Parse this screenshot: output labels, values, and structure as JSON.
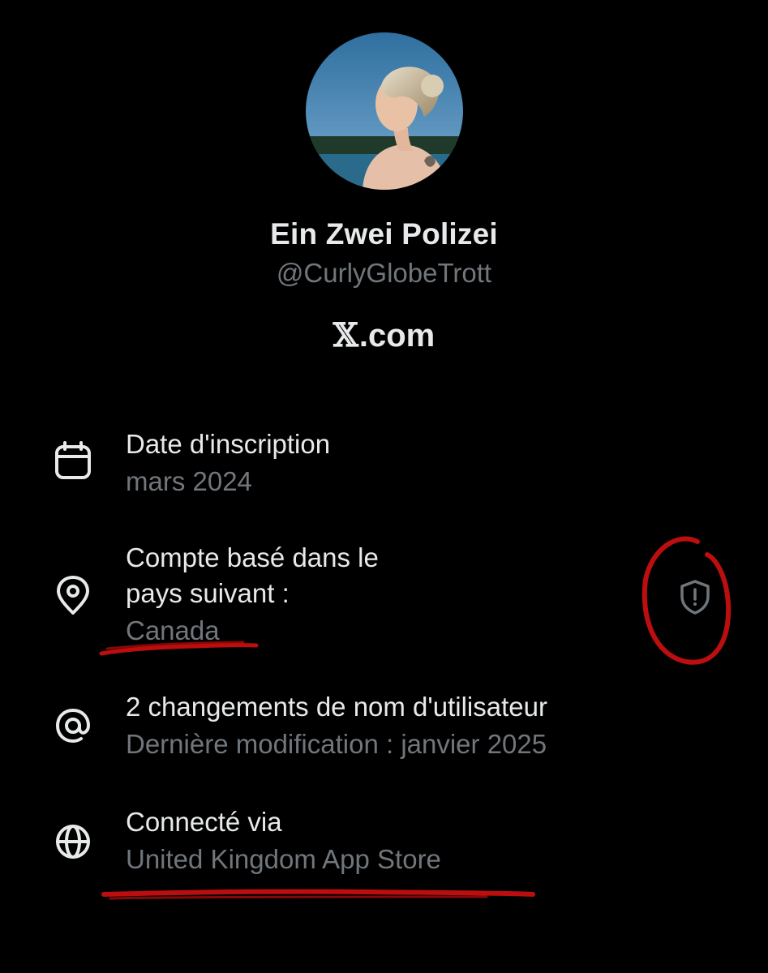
{
  "profile": {
    "display_name": "Ein Zwei Polizei",
    "handle": "@CurlyGlobeTrott",
    "brand_x": "𝕏",
    "brand_suffix": ".com"
  },
  "rows": [
    {
      "icon": "calendar-icon",
      "title": "Date d'inscription",
      "subtitle": "mars 2024"
    },
    {
      "icon": "location-pin-icon",
      "title_line1": "Compte basé dans le",
      "title_line2": "pays suivant :",
      "subtitle": "Canada",
      "action_icon": "shield-alert-icon"
    },
    {
      "icon": "at-icon",
      "title": "2 changements de nom d'utilisateur",
      "subtitle": "Dernière modification : janvier 2025"
    },
    {
      "icon": "globe-icon",
      "title": "Connecté via",
      "subtitle": "United Kingdom App Store"
    }
  ],
  "colors": {
    "background": "#000000",
    "primary_text": "#e7e9ea",
    "secondary_text": "#71767b",
    "annotation": "#d01010"
  }
}
